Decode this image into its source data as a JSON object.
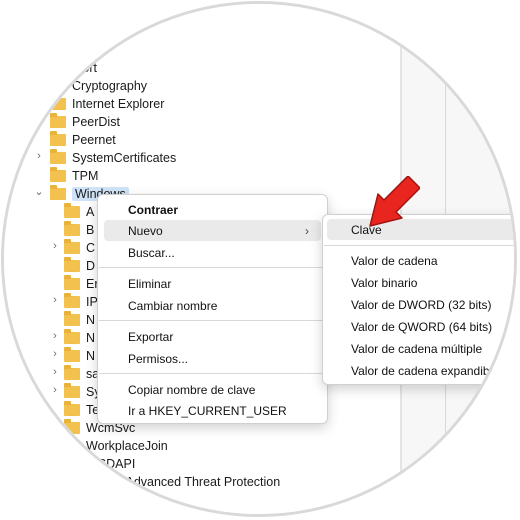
{
  "tree": {
    "items": [
      {
        "label": "...ort"
      },
      {
        "label": "Cryptography"
      },
      {
        "label": "Internet Explorer"
      },
      {
        "label": "PeerDist"
      },
      {
        "label": "Peernet"
      },
      {
        "label": "SystemCertificates"
      },
      {
        "label": "TPM"
      },
      {
        "label": "Windows"
      }
    ],
    "children": [
      {
        "label": "A"
      },
      {
        "label": "B"
      },
      {
        "label": "C"
      },
      {
        "label": "D"
      },
      {
        "label": "Er"
      },
      {
        "label": "IP"
      },
      {
        "label": "N"
      },
      {
        "label": "N"
      },
      {
        "label": "N"
      },
      {
        "label": "sa"
      },
      {
        "label": "Sy"
      },
      {
        "label": "Te"
      }
    ],
    "tail": [
      {
        "label": "WcmSvc"
      },
      {
        "label": "WorkplaceJoin"
      },
      {
        "label": "WSDAPI"
      },
      {
        "label": "Windows Advanced Threat Protection"
      }
    ]
  },
  "context_menu": {
    "items": [
      {
        "label": "Contraer"
      },
      {
        "label": "Nuevo"
      },
      {
        "label": "Buscar..."
      },
      {
        "label": "Eliminar"
      },
      {
        "label": "Cambiar nombre"
      },
      {
        "label": "Exportar"
      },
      {
        "label": "Permisos..."
      },
      {
        "label": "Copiar nombre de clave"
      },
      {
        "label": "Ir a HKEY_CURRENT_USER"
      }
    ],
    "submenu_arrow": "›"
  },
  "submenu": {
    "items": [
      {
        "label": "Clave"
      },
      {
        "label": "Valor de cadena"
      },
      {
        "label": "Valor binario"
      },
      {
        "label": "Valor de DWORD (32 bits)"
      },
      {
        "label": "Valor de QWORD (64 bits)"
      },
      {
        "label": "Valor de cadena múltiple"
      },
      {
        "label": "Valor de cadena expandible"
      }
    ]
  },
  "icons": {
    "folder": "folder-icon",
    "expand": "chevron-right-icon",
    "collapse": "chevron-down-icon",
    "pointer": "red-arrow-icon"
  },
  "colors": {
    "folder": "#f2c14e",
    "selection": "#cfe3f8",
    "arrow": "#e8251f"
  }
}
